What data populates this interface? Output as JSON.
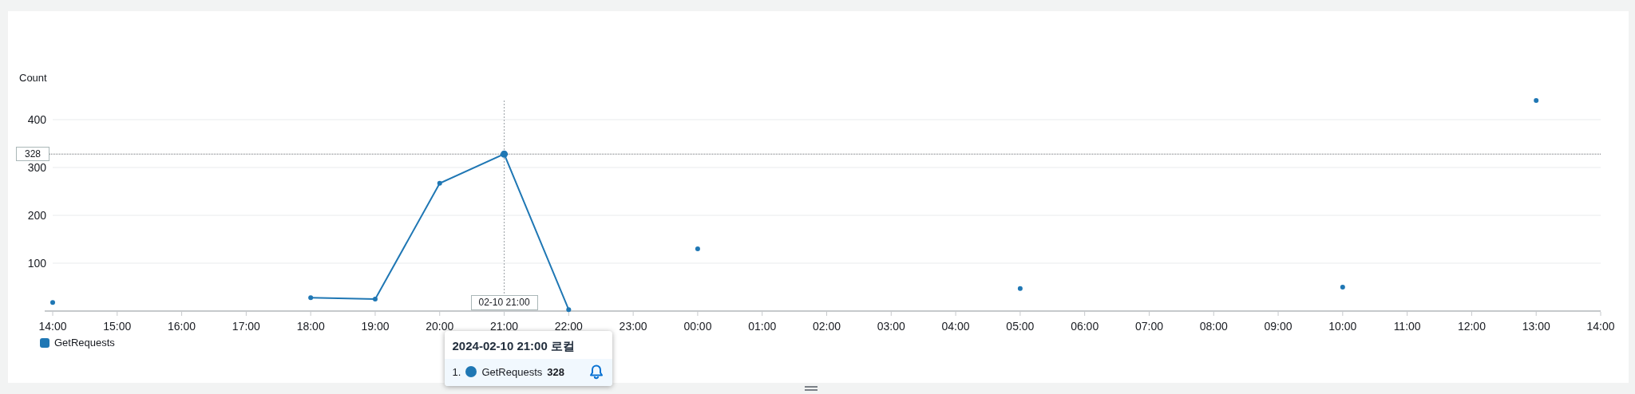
{
  "chart": {
    "chart_data": {
      "type": "line",
      "ylabel": "Count",
      "x": [
        "14:00",
        "15:00",
        "16:00",
        "17:00",
        "18:00",
        "19:00",
        "20:00",
        "21:00",
        "22:00",
        "23:00",
        "00:00",
        "01:00",
        "02:00",
        "03:00",
        "04:00",
        "05:00",
        "06:00",
        "07:00",
        "08:00",
        "09:00",
        "10:00",
        "11:00",
        "12:00",
        "13:00",
        "14:00"
      ],
      "series": [
        {
          "name": "GetRequests",
          "color": "#1f77b4",
          "marker": "circle",
          "values": [
            18,
            null,
            null,
            null,
            28,
            25,
            267,
            328,
            3,
            null,
            130,
            null,
            null,
            null,
            null,
            47,
            null,
            null,
            null,
            null,
            50,
            null,
            null,
            440,
            null
          ]
        }
      ],
      "ylim": [
        0,
        440
      ],
      "yticks": [
        100,
        200,
        300,
        400
      ],
      "grid": true,
      "ref_lines": [
        {
          "axis": "y",
          "value": 328,
          "label": "328"
        },
        {
          "axis": "x",
          "value": "21:00",
          "label": "02-10 21:00"
        }
      ]
    },
    "tooltip": {
      "title": "2024-02-10 21:00 로컬",
      "rows": [
        {
          "index": "1.",
          "name": "GetRequests",
          "value": "328",
          "color": "#1f77b4"
        }
      ]
    }
  }
}
